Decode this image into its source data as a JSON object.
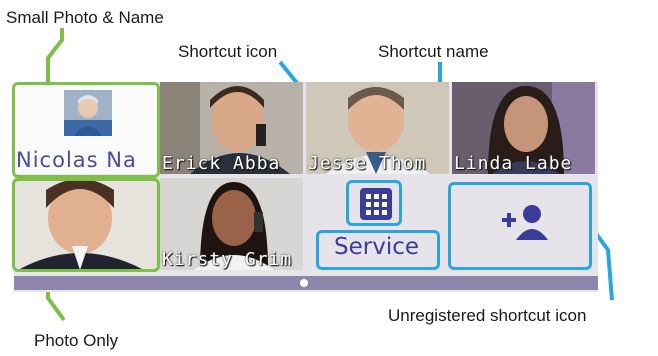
{
  "callouts": {
    "small_photo_name": "Small Photo & Name",
    "shortcut_icon": "Shortcut icon",
    "shortcut_name": "Shortcut name",
    "photo_only": "Photo Only",
    "unregistered": "Unregistered shortcut icon"
  },
  "tiles": {
    "t1": "Nicolas Na",
    "t2": "Erick Abba",
    "t3": "Jesse Thom",
    "t4": "Linda Labe",
    "t6": "Kirsty Grim",
    "t7": "Service"
  },
  "icons": {
    "shortcut": "grid-icon",
    "add_contact": "add-contact-icon"
  },
  "colors": {
    "callout_green": "#7ebf4a",
    "callout_blue": "#2aa6dd",
    "scrollbar": "#8f86ad"
  }
}
